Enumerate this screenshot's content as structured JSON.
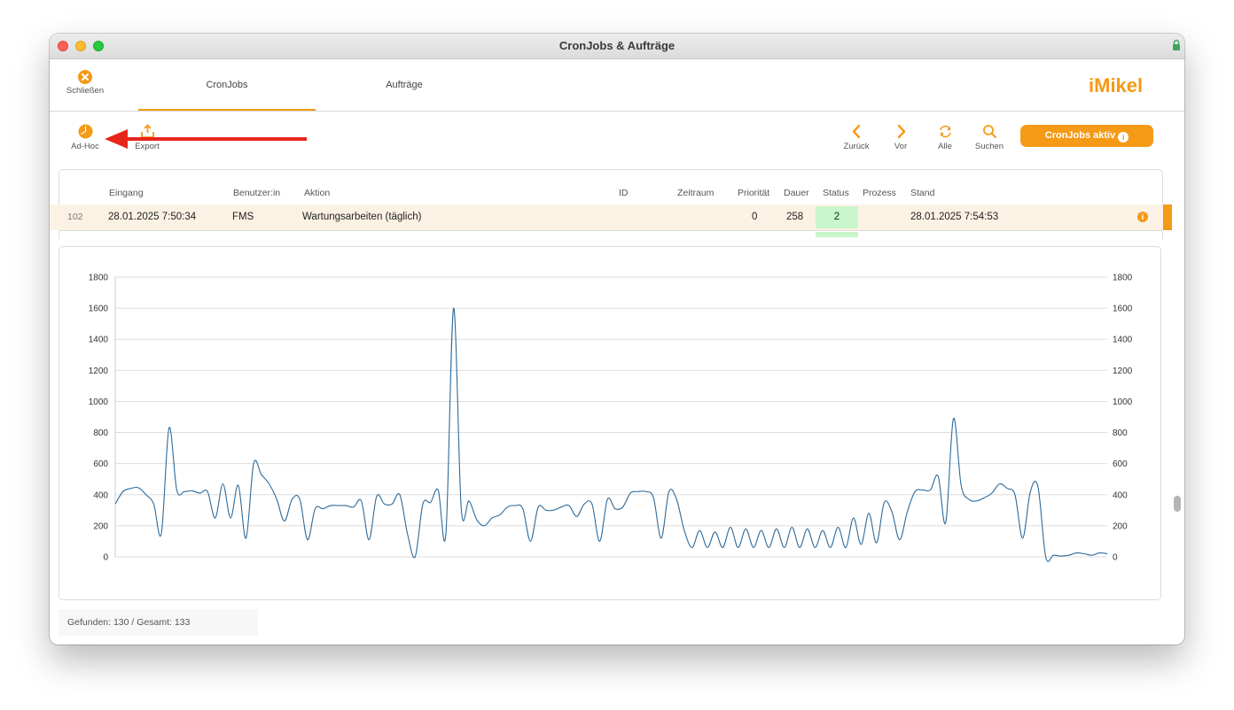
{
  "window": {
    "title": "CronJobs & Aufträge"
  },
  "nav": {
    "close_label": "Schließen",
    "tabs": [
      {
        "label": "CronJobs",
        "active": true
      },
      {
        "label": "Aufträge",
        "active": false
      }
    ],
    "logo_text": "iMikel"
  },
  "toolbar": {
    "adhoc_label": "Ad-Hoc",
    "export_label": "Export",
    "back_label": "Zurück",
    "forward_label": "Vor",
    "all_label": "Alle",
    "search_label": "Suchen",
    "cronjobs_active_label": "CronJobs aktiv",
    "info_glyph": "i"
  },
  "table": {
    "headers": {
      "eingang": "Eingang",
      "benutzer": "Benutzer:in",
      "aktion": "Aktion",
      "id": "ID",
      "zeitraum": "Zeitraum",
      "prioritaet": "Priorität",
      "dauer": "Dauer",
      "status": "Status",
      "prozess": "Prozess",
      "stand": "Stand"
    },
    "selected_row": {
      "nr": "102",
      "eingang": "28.01.2025 7:50:34",
      "benutzer": "FMS",
      "aktion": "Wartungsarbeiten (täglich)",
      "id": "",
      "zeitraum": "",
      "prioritaet": "0",
      "dauer": "258",
      "status": "2",
      "prozess": "",
      "stand": "28.01.2025 7:54:53",
      "info_glyph": "i"
    }
  },
  "colors": {
    "accent": "#f59a16",
    "line": "#2d6a9a",
    "status_ok": "#c9f6cb",
    "arrow": "#e8251a"
  },
  "icons": [
    "close-circle-icon",
    "pie-chart-icon",
    "export-icon",
    "chevron-left-icon",
    "chevron-right-icon",
    "refresh-icon",
    "search-icon",
    "info-icon",
    "lock-icon"
  ],
  "chart_data": {
    "type": "line",
    "ylim": [
      0,
      1800
    ],
    "y_ticks": [
      0,
      200,
      400,
      600,
      800,
      1000,
      1200,
      1400,
      1600,
      1800
    ],
    "grid": true,
    "series": [
      {
        "values": [
          340,
          420,
          440,
          445,
          400,
          340,
          150,
          830,
          430,
          420,
          425,
          410,
          420,
          250,
          470,
          250,
          460,
          120,
          600,
          530,
          470,
          370,
          230,
          370,
          370,
          110,
          310,
          310,
          330,
          330,
          330,
          320,
          360,
          110,
          390,
          340,
          340,
          400,
          150,
          0,
          340,
          350,
          430,
          150,
          1600,
          310,
          360,
          240,
          200,
          250,
          270,
          320,
          330,
          310,
          100,
          320,
          300,
          300,
          320,
          330,
          260,
          340,
          340,
          100,
          370,
          310,
          320,
          410,
          420,
          420,
          380,
          120,
          420,
          370,
          170,
          60,
          170,
          60,
          160,
          60,
          190,
          60,
          180,
          60,
          170,
          60,
          180,
          60,
          190,
          60,
          180,
          60,
          170,
          60,
          190,
          60,
          250,
          80,
          280,
          90,
          350,
          290,
          110,
          290,
          420,
          430,
          430,
          520,
          220,
          890,
          460,
          370,
          360,
          380,
          410,
          470,
          440,
          400,
          120,
          420,
          450,
          0,
          10,
          5,
          10,
          25,
          20,
          10,
          25,
          20
        ]
      }
    ]
  },
  "status": {
    "found_text": "Gefunden: 130 / Gesamt: 133"
  }
}
